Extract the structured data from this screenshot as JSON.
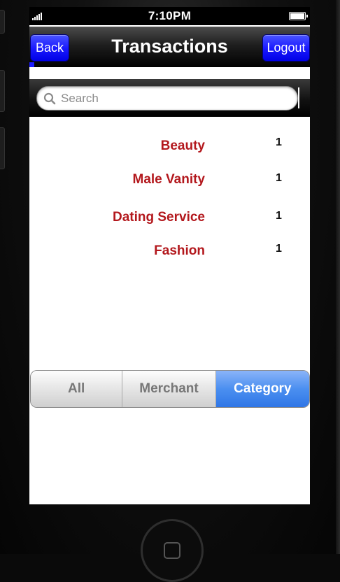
{
  "status_bar": {
    "time": "7:10PM"
  },
  "nav": {
    "title": "Transactions",
    "back_label": "Back",
    "logout_label": "Logout"
  },
  "search": {
    "placeholder": "Search",
    "value": ""
  },
  "rows": [
    {
      "name": "Beauty",
      "count": "1"
    },
    {
      "name": "Male Vanity",
      "count": "1"
    },
    {
      "name": "Dating Service",
      "count": "1"
    },
    {
      "name": "Fashion",
      "count": "1"
    }
  ],
  "segments": {
    "all": "All",
    "merchant": "Merchant",
    "category": "Category",
    "selected": "Category"
  },
  "colors": {
    "nav_button": "#1b1bff",
    "row_label": "#b3181d",
    "segment_active": "#4b8ff0"
  }
}
